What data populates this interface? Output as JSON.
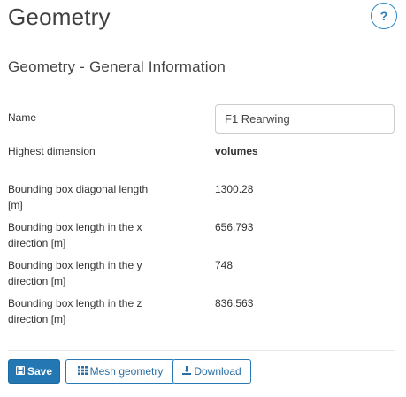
{
  "header": {
    "title": "Geometry",
    "help_label": "?"
  },
  "section": {
    "title": "Geometry - General Information"
  },
  "fields": {
    "name_label": "Name",
    "name_value": "F1 Rearwing",
    "highest_dimension_label": "Highest dimension",
    "highest_dimension_value": "volumes",
    "bbox_diag_label": "Bounding box diagonal length [m]",
    "bbox_diag_value": "1300.28",
    "bbox_x_label": "Bounding box length in the x direction [m]",
    "bbox_x_value": "656.793",
    "bbox_y_label": "Bounding box length in the y direction [m]",
    "bbox_y_value": "748",
    "bbox_z_label": "Bounding box length in the z direction [m]",
    "bbox_z_value": "836.563"
  },
  "actions": {
    "save_label": "Save",
    "mesh_label": "Mesh geometry",
    "download_label": "Download"
  },
  "icons": {
    "save": "floppy-disk-icon",
    "mesh": "grid-icon",
    "download": "download-icon"
  },
  "colors": {
    "primary": "#2378b4",
    "accent_border": "#2a7ab8"
  }
}
